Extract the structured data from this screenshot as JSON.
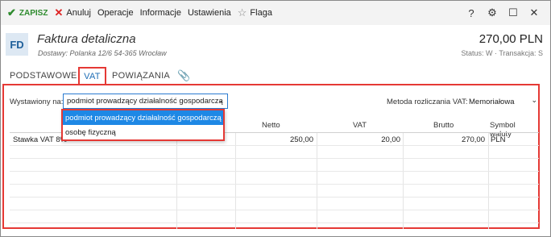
{
  "toolbar": {
    "save_label": "ZAPISZ",
    "cancel_label": "Anuluj",
    "operations_label": "Operacje",
    "info_label": "Informacje",
    "settings_label": "Ustawienia",
    "flag_label": "Flaga",
    "help_glyph": "?",
    "gear_glyph": "⚙",
    "maximize_glyph": "☐",
    "close_glyph": "✕"
  },
  "header": {
    "badge": "FD",
    "title": "Faktura detaliczna",
    "subtitle": "Dostawy: Polanka  12/6 54-365 Wrocław",
    "amount": "270,00 PLN",
    "status": "Status: W  ·  Transakcja: S"
  },
  "tabs": [
    {
      "label": "PODSTAWOWE"
    },
    {
      "label": "VAT"
    },
    {
      "label": "POWIĄZANIA"
    },
    {
      "label": "📎"
    }
  ],
  "form": {
    "issued_label": "Wystawiony na:",
    "issued_value": "podmiot prowadzący działalność gospodarczą",
    "method_label": "Metoda rozliczania VAT:",
    "method_value": "Memoriałowa"
  },
  "dropdown": {
    "options": [
      "podmiot prowadzący działalność gospodarczą",
      "osobę fizyczną"
    ]
  },
  "table": {
    "headers": {
      "netto": "Netto",
      "vat": "VAT",
      "brutto": "Brutto",
      "symbol": "Symbol waluty"
    },
    "rows": [
      {
        "name": "Stawka VAT 8%",
        "netto": "250,00",
        "vat": "20,00",
        "brutto": "270,00",
        "symbol": "PLN"
      }
    ]
  },
  "colors": {
    "accent": "#1e88e5",
    "highlight_border": "#e53935",
    "save_green": "#2e8b2e"
  }
}
